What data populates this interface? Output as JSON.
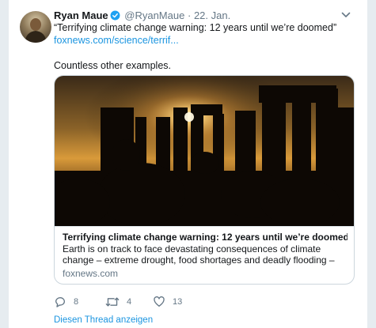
{
  "tweet": {
    "author_name": "Ryan Maue",
    "handle": "@RyanMaue",
    "separator": "·",
    "date": "22. Jan.",
    "quote_text": "“Terrifying climate change warning: 12 years until we’re doomed”",
    "link_text": "foxnews.com/science/terrif...",
    "extra_text": "Countless other examples."
  },
  "link_card": {
    "title": "Terrifying climate change warning: 12 years until we’re doomed",
    "description": "Earth is on track to face devastating consequences of climate change – extreme drought, food shortages and deadly flooding – unless there’s an “...",
    "domain": "foxnews.com"
  },
  "actions": {
    "reply_count": "8",
    "retweet_count": "4",
    "like_count": "13"
  },
  "thread_link": "Diesen Thread anzeigen",
  "icons": {
    "verified": "verified-badge-icon",
    "caret": "chevron-down-icon",
    "reply": "reply-icon",
    "retweet": "retweet-icon",
    "like": "heart-icon"
  },
  "colors": {
    "link": "#1b95e0",
    "secondary_text": "#657786",
    "primary_text": "#14171a",
    "verified": "#1da1f2",
    "background": "#e6ecf0"
  }
}
